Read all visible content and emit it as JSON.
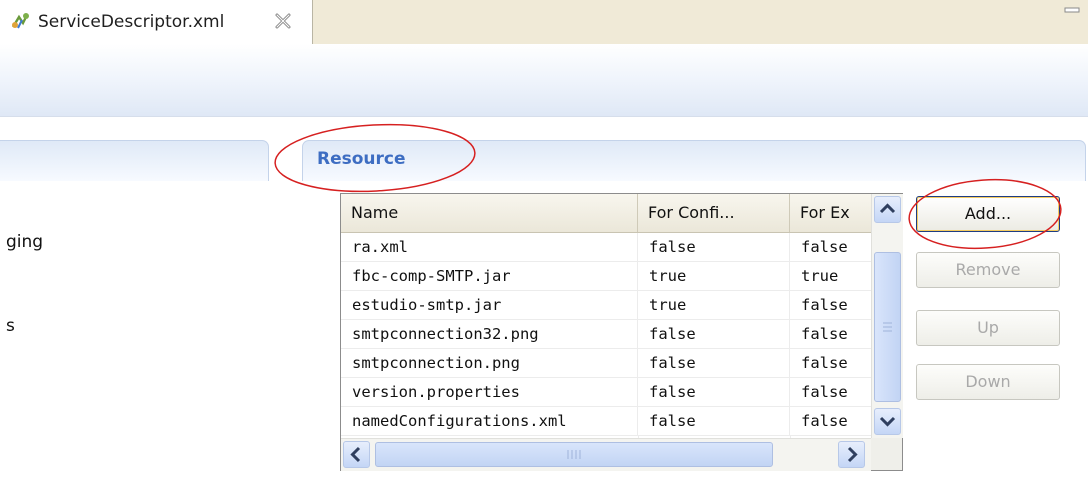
{
  "editor_tab": {
    "title": "ServiceDescriptor.xml",
    "icon": "xml-descriptor-icon",
    "close_icon": "close-icon"
  },
  "window": {
    "minimize_icon": "minimize-icon"
  },
  "left_section": {
    "partial_text_1": "ging",
    "partial_text_2": "s"
  },
  "resource_section": {
    "title": "Resource"
  },
  "table": {
    "columns": [
      "Name",
      "For Confi...",
      "For Ex"
    ],
    "rows": [
      [
        "ra.xml",
        "false",
        "false"
      ],
      [
        "fbc-comp-SMTP.jar",
        "true",
        "true"
      ],
      [
        "estudio-smtp.jar",
        "true",
        "false"
      ],
      [
        "smtpconnection32.png",
        "false",
        "false"
      ],
      [
        "smtpconnection.png",
        "false",
        "false"
      ],
      [
        "version.properties",
        "false",
        "false"
      ],
      [
        "namedConfigurations.xml",
        "false",
        "false"
      ]
    ]
  },
  "buttons": {
    "add": "Add...",
    "remove": "Remove",
    "up": "Up",
    "down": "Down"
  },
  "colors": {
    "tab_bar": "#f0ead7",
    "section_title": "#3d6dc2",
    "annotation": "#d62020"
  }
}
